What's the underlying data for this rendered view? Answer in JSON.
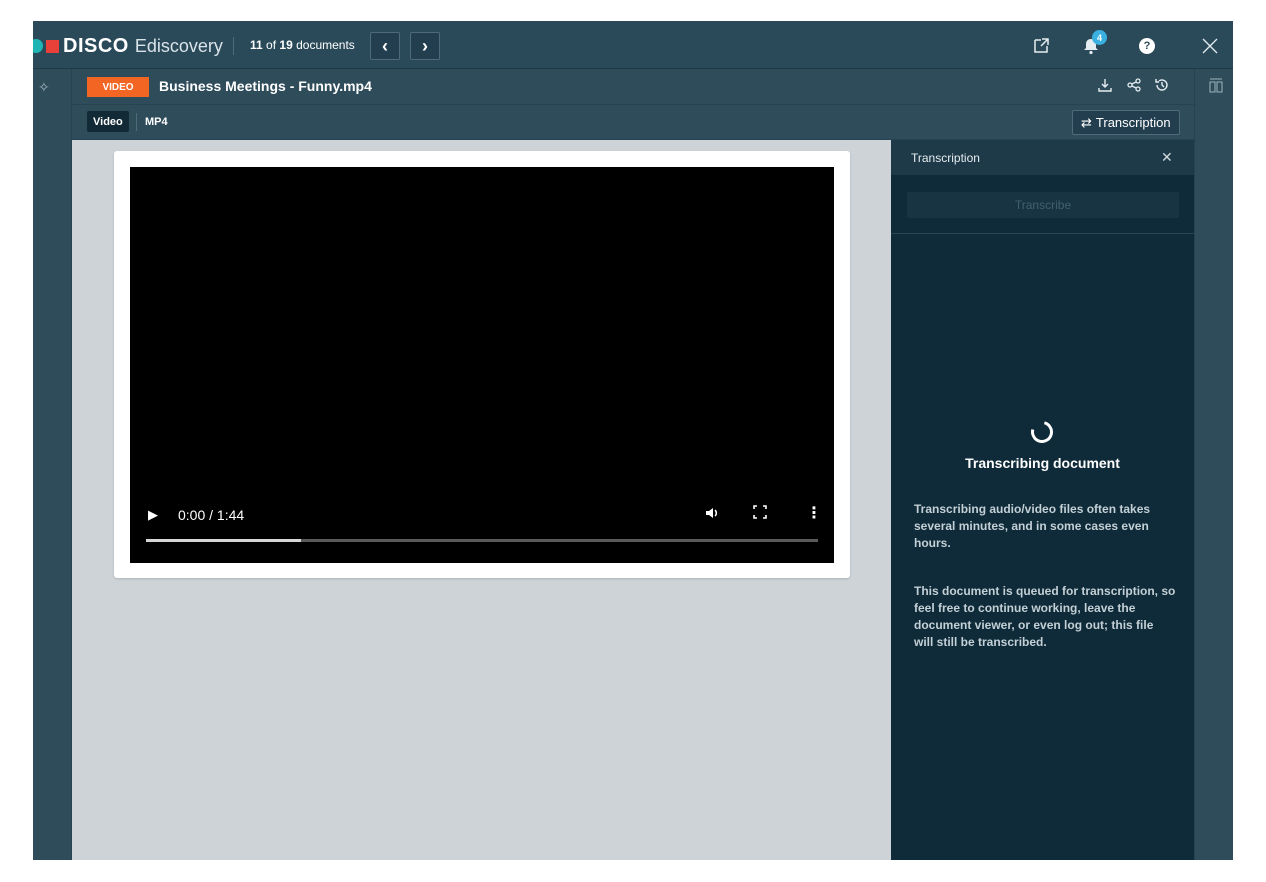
{
  "topbar": {
    "brand": "DISCO",
    "brand_sub": "Ediscovery",
    "doc_current": "11",
    "doc_of": "of",
    "doc_total": "19",
    "doc_label": "documents",
    "prev_glyph": "‹",
    "next_glyph": "›",
    "notification_count": "4",
    "help_glyph": "?"
  },
  "document": {
    "type_badge": "VIDEO",
    "title": "Business Meetings - Funny.mp4",
    "format_chip": "Video",
    "format_ext": "MP4",
    "transcription_button": "Transcription"
  },
  "player": {
    "time": "0:00 / 1:44",
    "buffered_fraction": 0.23
  },
  "transcription_panel": {
    "title": "Transcription",
    "transcribe_button": "Transcribe",
    "status": "Transcribing document",
    "paragraph1": "Transcribing audio/video files often takes several minutes, and in some cases even hours.",
    "paragraph2": "This document is queued for transcription, so feel free to continue working, leave the document viewer, or even log out; this file will still be transcribed."
  },
  "colors": {
    "brand_teal": "#1fb5b5",
    "brand_red": "#e8413a",
    "video_badge": "#f26522",
    "notification_badge": "#3ab0e0"
  }
}
